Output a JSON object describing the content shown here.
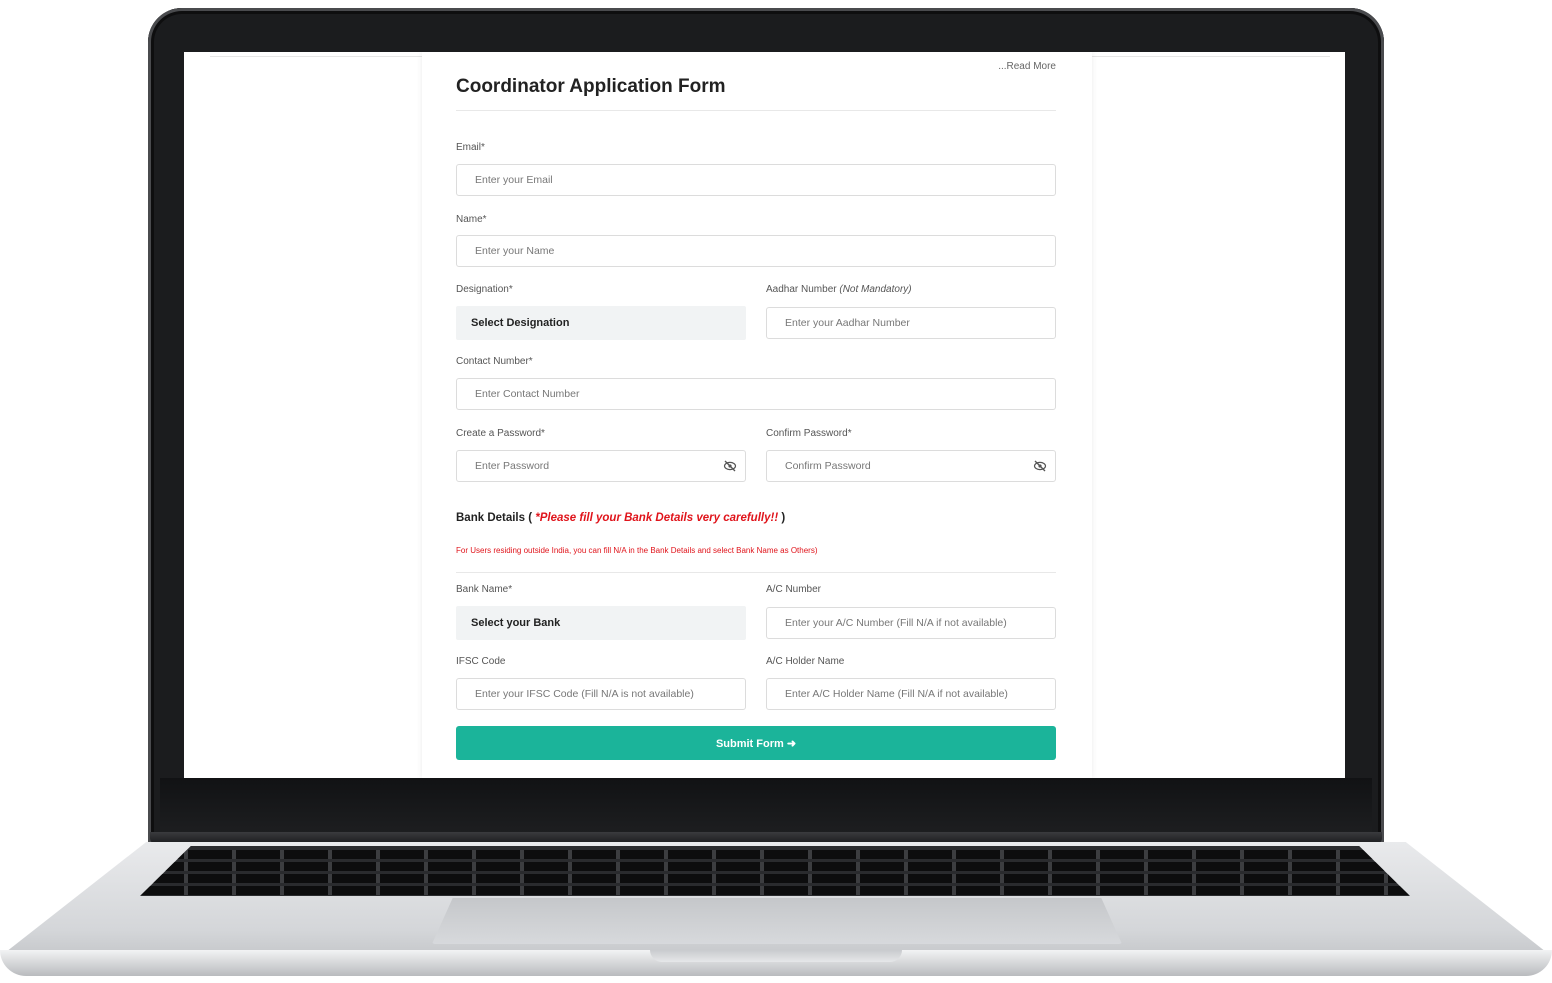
{
  "page": {
    "read_more": "...Read More",
    "title": "Coordinator Application Form"
  },
  "fields": {
    "email": {
      "label": "Email*",
      "placeholder": "Enter your Email"
    },
    "name": {
      "label": "Name*",
      "placeholder": "Enter your Name"
    },
    "designation": {
      "label": "Designation*",
      "value": "Select Designation"
    },
    "aadhar": {
      "label": "Aadhar Number",
      "label_note": "(Not Mandatory)",
      "placeholder": "Enter your Aadhar Number"
    },
    "contact": {
      "label": "Contact Number*",
      "placeholder": "Enter Contact Number"
    },
    "password": {
      "label": "Create a Password*",
      "placeholder": "Enter Password"
    },
    "confirm_password": {
      "label": "Confirm Password*",
      "placeholder": "Confirm Password"
    }
  },
  "bank": {
    "heading_prefix": "Bank Details (",
    "heading_warning": "*Please fill your Bank Details very carefully!!",
    "heading_suffix": ")",
    "note": "For Users residing outside India, you can fill N/A in the Bank Details and select Bank Name as Others)",
    "bank_name": {
      "label": "Bank Name*",
      "value": "Select your Bank"
    },
    "ac_number": {
      "label": "A/C Number",
      "placeholder": "Enter your A/C Number (Fill N/A if not available)"
    },
    "ifsc": {
      "label": "IFSC Code",
      "placeholder": "Enter your IFSC Code (Fill N/A is not available)"
    },
    "ac_holder": {
      "label": "A/C Holder Name",
      "placeholder": "Enter A/C Holder Name (Fill N/A if not available)"
    }
  },
  "submit": {
    "label": "Submit Form ➜"
  },
  "colors": {
    "accent": "#1bb49a",
    "warning": "#e0141b"
  },
  "icons": {
    "password_toggle": "eye-off-icon"
  }
}
